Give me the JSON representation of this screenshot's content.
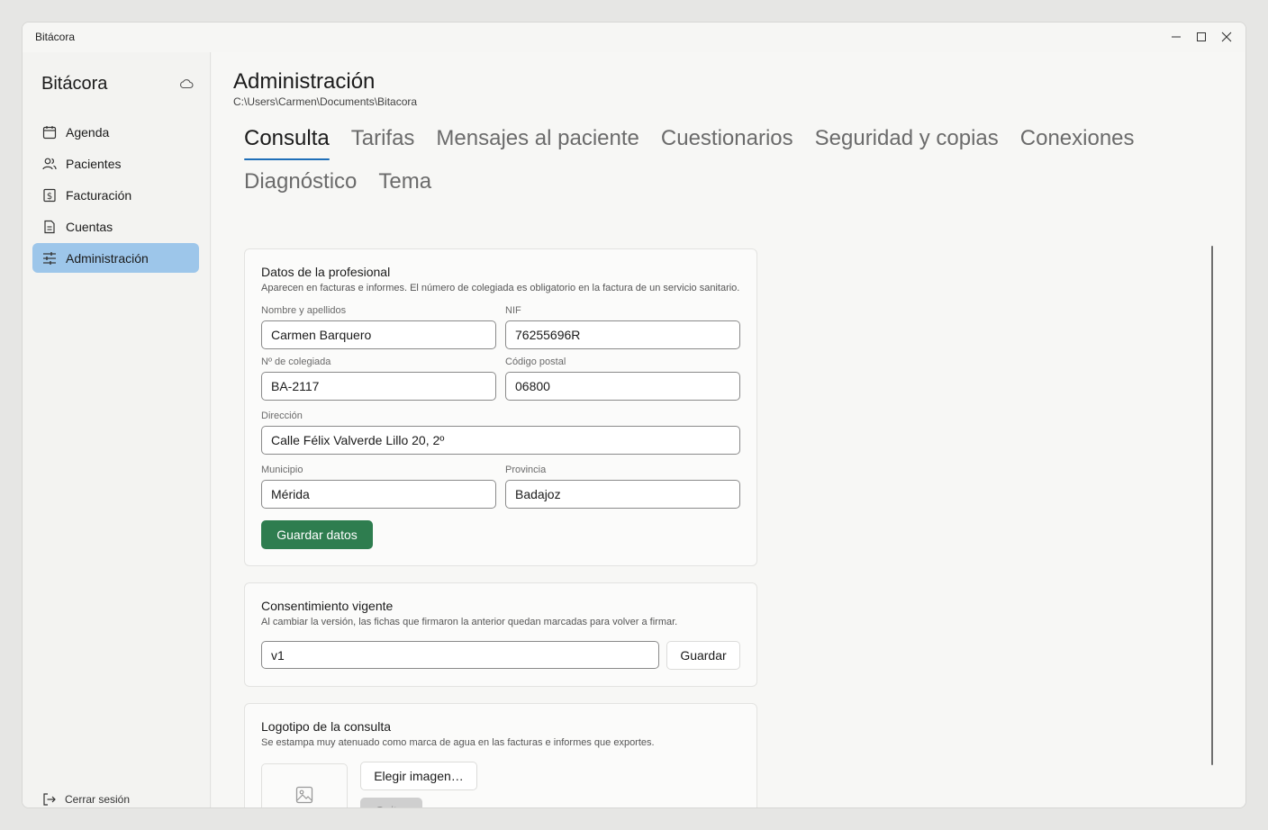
{
  "window": {
    "title": "Bitácora"
  },
  "sidebar": {
    "app_name": "Bitácora",
    "items": [
      {
        "label": "Agenda",
        "icon": "calendar-icon",
        "active": false
      },
      {
        "label": "Pacientes",
        "icon": "people-icon",
        "active": false
      },
      {
        "label": "Facturación",
        "icon": "invoice-dollar-icon",
        "active": false
      },
      {
        "label": "Cuentas",
        "icon": "document-icon",
        "active": false
      },
      {
        "label": "Administración",
        "icon": "sliders-icon",
        "active": true
      }
    ],
    "logout_label": "Cerrar sesión"
  },
  "header": {
    "title": "Administración",
    "path": "C:\\Users\\Carmen\\Documents\\Bitacora"
  },
  "tabs": [
    {
      "label": "Consulta",
      "active": true
    },
    {
      "label": "Tarifas",
      "active": false
    },
    {
      "label": "Mensajes al paciente",
      "active": false
    },
    {
      "label": "Cuestionarios",
      "active": false
    },
    {
      "label": "Seguridad y copias",
      "active": false
    },
    {
      "label": "Conexiones",
      "active": false
    },
    {
      "label": "Diagnóstico",
      "active": false
    },
    {
      "label": "Tema",
      "active": false
    }
  ],
  "profesional": {
    "title": "Datos de la profesional",
    "description": "Aparecen en facturas e informes. El número de colegiada es obligatorio en la factura de un servicio sanitario.",
    "fields": {
      "nombre": {
        "label": "Nombre y apellidos",
        "value": "Carmen Barquero"
      },
      "nif": {
        "label": "NIF",
        "value": "76255696R"
      },
      "colegiada": {
        "label": "Nº de colegiada",
        "value": "BA-2117"
      },
      "cp": {
        "label": "Código postal",
        "value": "06800"
      },
      "direccion": {
        "label": "Dirección",
        "value": "Calle Félix Valverde Lillo 20, 2º"
      },
      "municipio": {
        "label": "Municipio",
        "value": "Mérida"
      },
      "provincia": {
        "label": "Provincia",
        "value": "Badajoz"
      }
    },
    "save_label": "Guardar datos"
  },
  "consentimiento": {
    "title": "Consentimiento vigente",
    "description": "Al cambiar la versión, las fichas que firmaron la anterior quedan marcadas para volver a firmar.",
    "version_value": "v1",
    "save_label": "Guardar"
  },
  "logotipo": {
    "title": "Logotipo de la consulta",
    "description": "Se estampa muy atenuado como marca de agua en las facturas e informes que exportes.",
    "choose_label": "Elegir imagen…",
    "remove_label": "Quitar"
  },
  "colors": {
    "accent": "#1f6fb8",
    "primary_button": "#2e7d4f",
    "active_nav": "#9dc6ea"
  }
}
